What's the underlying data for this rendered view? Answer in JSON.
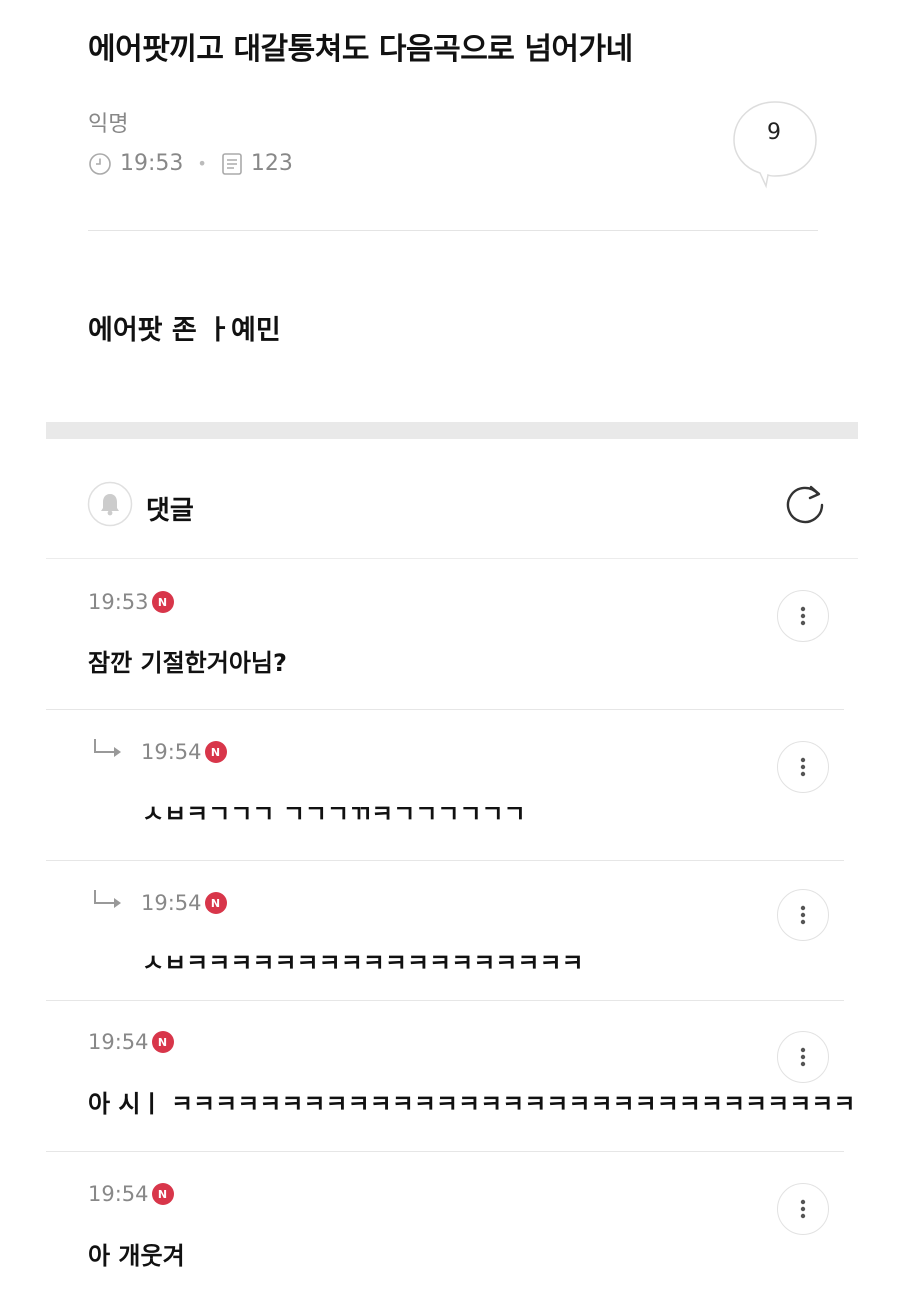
{
  "post": {
    "title": "에어팟끼고 대갈통쳐도 다음곡으로 넘어가네",
    "author": "익명",
    "time": "19:53",
    "views": "123",
    "comment_count": "9",
    "body": "에어팟 존 ㅏ예민"
  },
  "comments_header": {
    "label": "댓글"
  },
  "comments": [
    {
      "time": "19:53",
      "badge": "N",
      "text": "잠깐 기절한거아님?",
      "is_reply": false
    },
    {
      "time": "19:54",
      "badge": "N",
      "text": "ㅅㅂㅋㄱㄱㄱ ㄱㄱㄱㄲㅋㄱㄱㄱㄱㄱㄱ",
      "is_reply": true
    },
    {
      "time": "19:54",
      "badge": "N",
      "text": "ㅅㅂㅋㅋㅋㅋㅋㅋㅋㅋㅋㅋㅋㅋㅋㅋㅋㅋㅋㅋ",
      "is_reply": true
    },
    {
      "time": "19:54",
      "badge": "N",
      "text": "아 시ㅣ ㅋㅋㅋㅋㅋㅋㅋㅋㅋㅋㅋㅋㅋㅋㅋㅋㅋㅋㅋㅋㅋㅋㅋㅋㅋㅋㅋㅋㅋㅋㅋ",
      "is_reply": false
    },
    {
      "time": "19:54",
      "badge": "N",
      "text": "아 개웃겨",
      "is_reply": false
    }
  ],
  "colors": {
    "badge": "#d8364a",
    "muted_text": "#888888"
  }
}
